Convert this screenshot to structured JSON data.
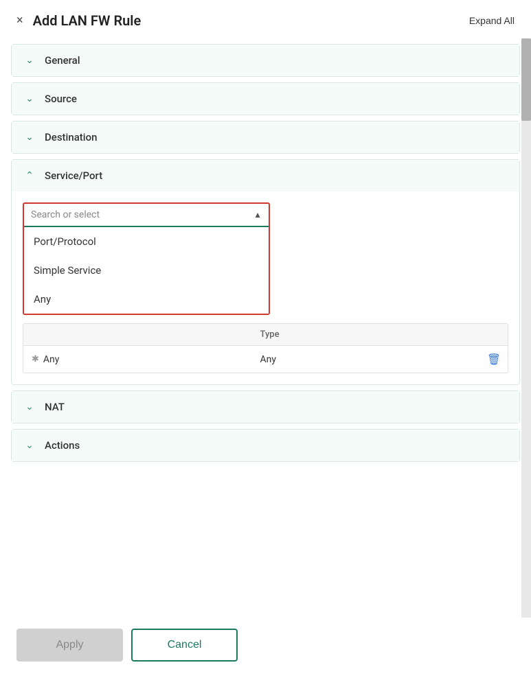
{
  "header": {
    "title": "Add LAN FW Rule",
    "expand_all_label": "Expand All",
    "close_icon": "×"
  },
  "sections": [
    {
      "id": "general",
      "label": "General",
      "expanded": false,
      "chevron": "chevron-down"
    },
    {
      "id": "source",
      "label": "Source",
      "expanded": false,
      "chevron": "chevron-down"
    },
    {
      "id": "destination",
      "label": "Destination",
      "expanded": false,
      "chevron": "chevron-down"
    },
    {
      "id": "nat",
      "label": "NAT",
      "expanded": false,
      "chevron": "chevron-down"
    },
    {
      "id": "actions",
      "label": "Actions",
      "expanded": false,
      "chevron": "chevron-down"
    }
  ],
  "service_port": {
    "label": "Service/Port",
    "expanded": true,
    "chevron": "chevron-up",
    "dropdown": {
      "placeholder": "Search or select",
      "options": [
        {
          "label": "Port/Protocol"
        },
        {
          "label": "Simple Service"
        },
        {
          "label": "Any"
        }
      ]
    },
    "table": {
      "columns": [
        "",
        "Type"
      ],
      "rows": [
        {
          "col1": "Any",
          "col2": "Any"
        }
      ]
    }
  },
  "footer": {
    "apply_label": "Apply",
    "cancel_label": "Cancel"
  }
}
